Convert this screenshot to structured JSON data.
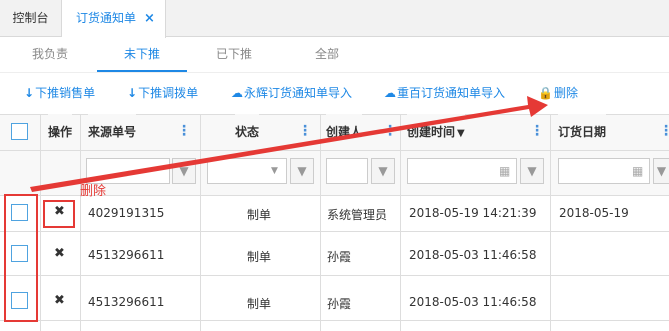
{
  "top_tabs": [
    {
      "label": "控制台"
    },
    {
      "label": "订货通知单",
      "close": "×"
    }
  ],
  "sub_tabs": [
    {
      "label": "我负责"
    },
    {
      "label": "未下推"
    },
    {
      "label": "已下推"
    },
    {
      "label": "全部"
    }
  ],
  "toolbar": {
    "push_sales": "下推销售单",
    "push_transfer": "下推调拨单",
    "import_yonghui": "永辉订货通知单导入",
    "import_chongbai": "重百订货通知单导入",
    "delete": "删除"
  },
  "columns": {
    "action": "操作",
    "source_no": "来源单号",
    "status": "状态",
    "creator": "创建人",
    "created_time": "创建时间",
    "order_date": "订货日期",
    "sort_indicator": "▼"
  },
  "rows": [
    {
      "source_no": "4029191315",
      "status": "制单",
      "creator": "系统管理员",
      "created_time": "2018-05-19 14:21:39",
      "order_date": "2018-05-19"
    },
    {
      "source_no": "4513296611",
      "status": "制单",
      "creator": "孙霞",
      "created_time": "2018-05-03 11:46:58",
      "order_date": ""
    },
    {
      "source_no": "4513296611",
      "status": "制单",
      "creator": "孙霞",
      "created_time": "2018-05-03 11:46:58",
      "order_date": ""
    }
  ],
  "annotation": {
    "label": "删除",
    "color": "#e53935"
  },
  "colors": {
    "accent": "#1e88e5"
  }
}
